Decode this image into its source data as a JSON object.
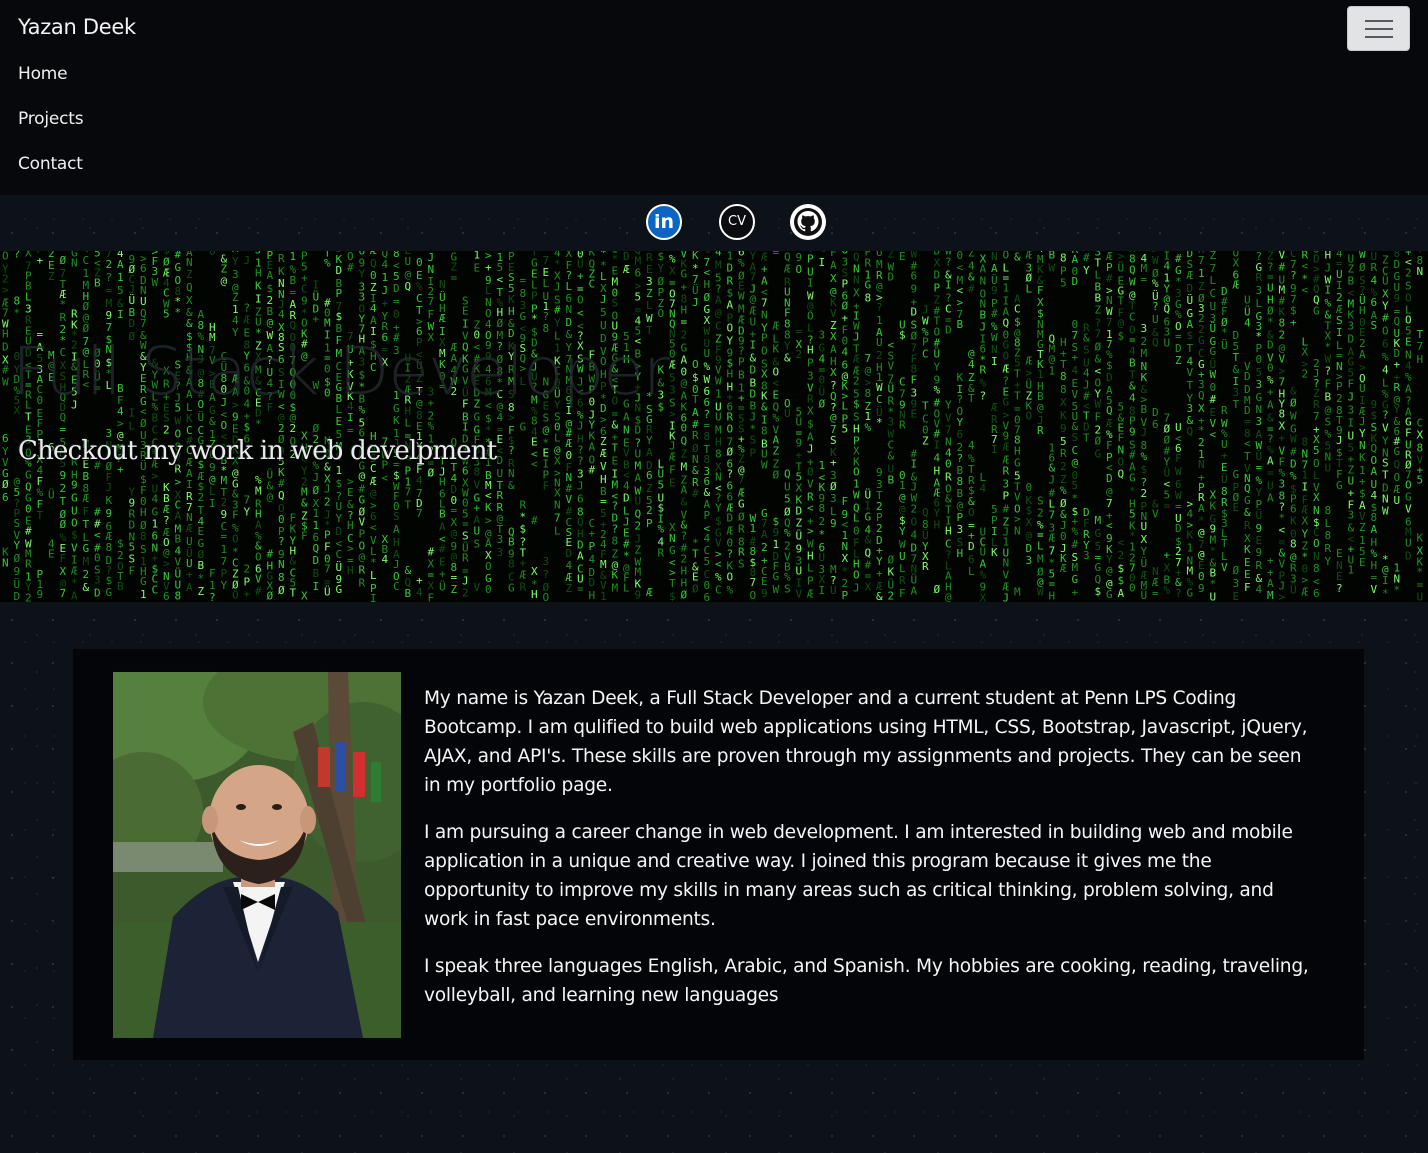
{
  "navbar": {
    "brand": "Yazan Deek",
    "items": [
      {
        "label": "Home"
      },
      {
        "label": "Projects"
      },
      {
        "label": "Contact"
      }
    ],
    "toggler_icon": "hamburger-icon"
  },
  "social": {
    "linkedin": {
      "icon": "linkedin-icon",
      "text": "in"
    },
    "cv": {
      "icon": "cv-icon",
      "text": "CV"
    },
    "github": {
      "icon": "github-icon"
    }
  },
  "hero": {
    "title": "Full Stack Developer",
    "subtitle": "Checkout my work in web develpment"
  },
  "about": {
    "paragraphs": [
      "My name is Yazan Deek, a Full Stack Developer and a current student at Penn LPS Coding Bootcamp. I am qulified to build web applications using HTML, CSS, Bootstrap, Javascript, jQuery, AJAX, and API's. These skills are proven through my assignments and projects. They can be seen in my portfolio page.",
      "I am pursuing a career change in web development. I am interested in building web and mobile application in a unique and creative way. I joined this program because it gives me the opportunity to improve my skills in many areas such as critical thinking, problem solving, and work in fast pace environments.",
      "I speak three languages English, Arabic, and Spanish. My hobbies are cooking, reading, traveling, volleyball, and learning new languages"
    ]
  },
  "colors": {
    "navbar_bg": "#07080b",
    "page_bg": "#0d1219",
    "card_bg": "#040508",
    "matrix_green": "#2ecc2e",
    "linkedin_blue": "#0a66c2"
  }
}
